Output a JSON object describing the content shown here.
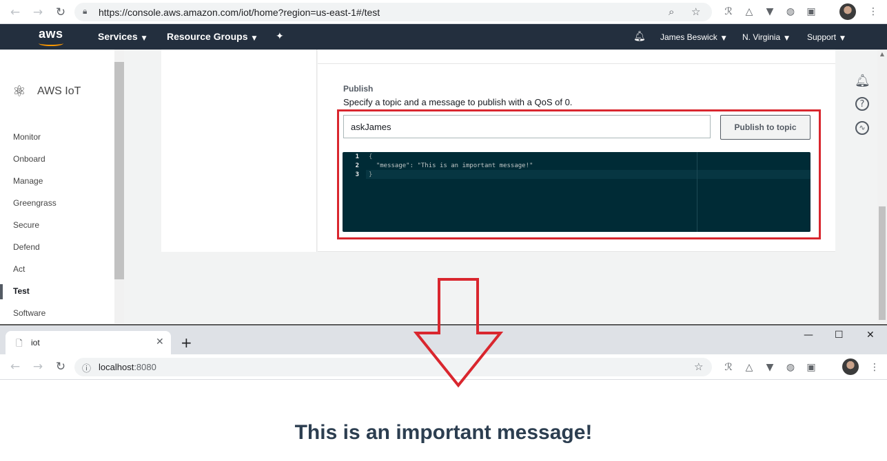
{
  "browser_top": {
    "url": "https://console.aws.amazon.com/iot/home?region=us-east-1#/test",
    "icons": [
      "back-icon",
      "forward-icon",
      "reload-icon",
      "lock-icon",
      "zoom-icon",
      "star-icon"
    ]
  },
  "aws_header": {
    "logo": "aws",
    "services": "Services",
    "resource_groups": "Resource Groups",
    "user": "James Beswick",
    "region": "N. Virginia",
    "support": "Support"
  },
  "sidebar": {
    "title": "AWS IoT",
    "items": [
      {
        "label": "Monitor"
      },
      {
        "label": "Onboard"
      },
      {
        "label": "Manage"
      },
      {
        "label": "Greengrass"
      },
      {
        "label": "Secure"
      },
      {
        "label": "Defend"
      },
      {
        "label": "Act"
      },
      {
        "label": "Test"
      },
      {
        "label": "Software"
      }
    ]
  },
  "publish": {
    "title": "Publish",
    "description": "Specify a topic and a message to publish with a QoS of 0.",
    "topic_value": "askJames",
    "button_label": "Publish to topic",
    "editor": {
      "line_numbers": [
        "1",
        "2",
        "3"
      ],
      "lines": [
        "{",
        "  \"message\": \"This is an important message!\"",
        "}"
      ]
    }
  },
  "browser_bottom": {
    "tab_title": "iot",
    "url_host": "localhost",
    "url_port": ":8080",
    "heading": "This is an important message!"
  },
  "colors": {
    "aws_nav_bg": "#232f3e",
    "highlight_red": "#d9262e",
    "editor_bg": "#002b36"
  }
}
